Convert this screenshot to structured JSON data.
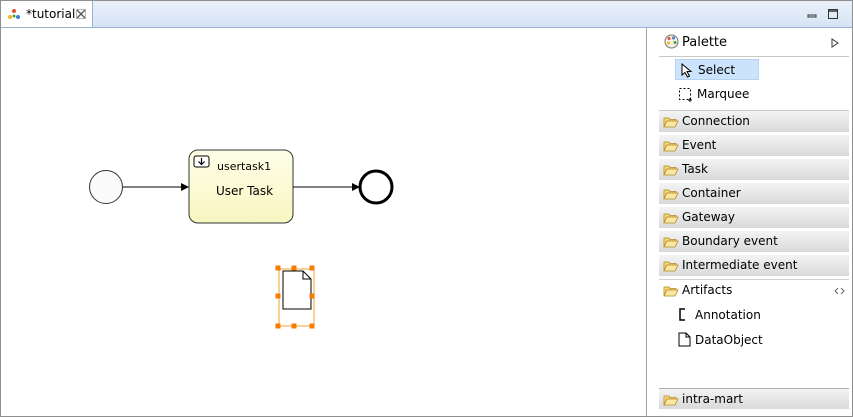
{
  "editor": {
    "tab_title": "*tutorial"
  },
  "diagram": {
    "task": {
      "id": "usertask1",
      "type_label": "User Task"
    }
  },
  "palette": {
    "title": "Palette",
    "tools": [
      {
        "label": "Select",
        "icon": "arrow-pointer-icon",
        "selected": true
      },
      {
        "label": "Marquee",
        "icon": "marquee-icon",
        "selected": false
      }
    ],
    "drawers": [
      {
        "label": "Connection"
      },
      {
        "label": "Event"
      },
      {
        "label": "Task"
      },
      {
        "label": "Container"
      },
      {
        "label": "Gateway"
      },
      {
        "label": "Boundary event"
      },
      {
        "label": "Intermediate event"
      }
    ],
    "artifacts": {
      "label": "Artifacts",
      "items": [
        {
          "label": "Annotation",
          "icon": "annotation-icon"
        },
        {
          "label": "DataObject",
          "icon": "data-object-icon"
        }
      ]
    },
    "bottom_drawer": {
      "label": "intra-mart"
    }
  }
}
